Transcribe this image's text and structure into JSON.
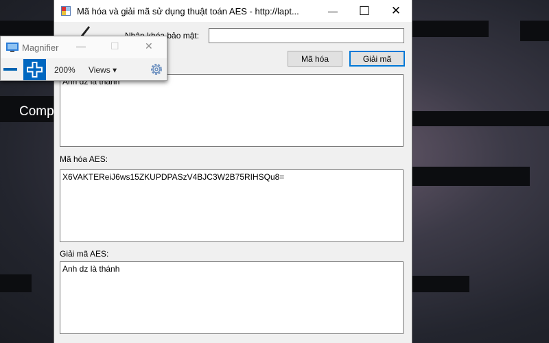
{
  "desktop": {
    "label": "Comp"
  },
  "app_window": {
    "title": "Mã hóa và giải mã sử dụng thuật toán AES - http://lapt...",
    "key_label": "Nhập khóa bảo mật:",
    "key_value": "",
    "encrypt_button": "Mã hóa",
    "decrypt_button": "Giải mã",
    "input_text": "Anh dz là thánh",
    "encrypted_label": "Mã hóa AES:",
    "encrypted_text": "X6VAKTEReiJ6ws15ZKUPDPASzV4BJC3W2B75RIHSQu8=",
    "decrypted_label": "Giải mã AES:",
    "decrypted_text": "Anh dz là thánh",
    "controls": {
      "minimize": "—",
      "maximize": "☐",
      "close": "✕"
    }
  },
  "magnifier": {
    "title": "Magnifier",
    "zoom": "200%",
    "views_label": "Views ▾",
    "controls": {
      "minimize": "—",
      "maximize": "☐",
      "close": "✕"
    }
  },
  "icons": [
    "app-icon",
    "logo-icon",
    "magnifier-app-icon",
    "zoom-out-icon",
    "zoom-in-icon",
    "settings-gear-icon"
  ]
}
